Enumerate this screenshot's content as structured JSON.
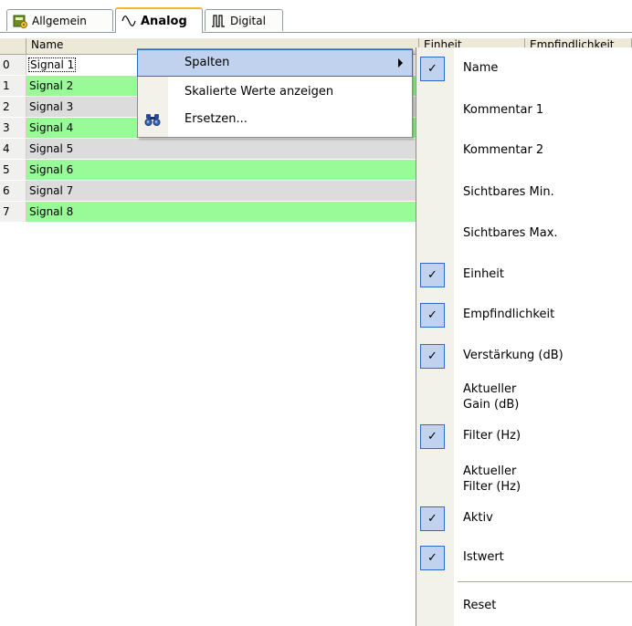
{
  "tabs": [
    {
      "label": "Allgemein",
      "icon": "settings-folder-icon"
    },
    {
      "label": "Analog",
      "icon": "sine-wave-icon",
      "active": true
    },
    {
      "label": "Digital",
      "icon": "pulse-wave-icon"
    }
  ],
  "grid": {
    "headers": [
      "Name",
      "Einheit",
      "Empfindlichkeit"
    ],
    "rows": [
      {
        "num": "0",
        "name": "Signal 1",
        "color": "white"
      },
      {
        "num": "1",
        "name": "Signal 2",
        "color": "green"
      },
      {
        "num": "2",
        "name": "Signal 3",
        "color": "gray"
      },
      {
        "num": "3",
        "name": "Signal 4",
        "color": "green"
      },
      {
        "num": "4",
        "name": "Signal 5",
        "color": "gray"
      },
      {
        "num": "5",
        "name": "Signal 6",
        "color": "green"
      },
      {
        "num": "6",
        "name": "Signal 7",
        "color": "gray"
      },
      {
        "num": "7",
        "name": "Signal 8",
        "color": "green"
      }
    ],
    "colors": {
      "green": "#98fb98",
      "gray": "#dcdcdc",
      "white": "#ffffff"
    }
  },
  "context_menu": {
    "items": [
      {
        "label": "Spalten",
        "has_submenu": true
      },
      {
        "label": "Skalierte Werte anzeigen"
      },
      {
        "label": "Ersetzen...",
        "icon": "binoculars-icon"
      }
    ]
  },
  "submenu": {
    "items": [
      {
        "label": "Name",
        "checked": true
      },
      {
        "label": "Kommentar 1",
        "checked": false
      },
      {
        "label": "Kommentar 2",
        "checked": false
      },
      {
        "label": "Sichtbares Min.",
        "checked": false
      },
      {
        "label": "Sichtbares Max.",
        "checked": false
      },
      {
        "label": "Einheit",
        "checked": true
      },
      {
        "label": "Empfindlichkeit",
        "checked": true
      },
      {
        "label": "Verstärkung (dB)",
        "checked": true
      },
      {
        "label": "Aktueller\nGain (dB)",
        "checked": false
      },
      {
        "label": "Filter (Hz)",
        "checked": true
      },
      {
        "label": "Aktueller\nFilter (Hz)",
        "checked": false
      },
      {
        "label": "Aktiv",
        "checked": true
      },
      {
        "label": "Istwert",
        "checked": true
      },
      {
        "label": "Reset"
      }
    ],
    "check_glyph": "✓",
    "highlight_color": "#c1d2ee"
  }
}
